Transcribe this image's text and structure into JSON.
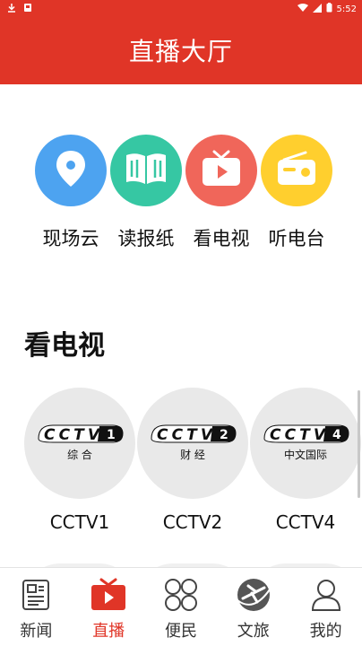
{
  "status_bar": {
    "time": "5:52"
  },
  "header": {
    "title": "直播大厅"
  },
  "quick_links": [
    {
      "label": "现场云",
      "icon": "location-pin-icon",
      "color": "#4da3f0"
    },
    {
      "label": "读报纸",
      "icon": "book-icon",
      "color": "#36c7a3"
    },
    {
      "label": "看电视",
      "icon": "tv-icon",
      "color": "#f0665a"
    },
    {
      "label": "听电台",
      "icon": "radio-icon",
      "color": "#ffcf2e"
    }
  ],
  "section": {
    "title": "看电视"
  },
  "channels": [
    {
      "name": "CCTV1",
      "logo_number": "1",
      "logo_caption": "综 合"
    },
    {
      "name": "CCTV2",
      "logo_number": "2",
      "logo_caption": "财 经"
    },
    {
      "name": "CCTV4",
      "logo_number": "4",
      "logo_caption": "中文国际"
    }
  ],
  "tabs": [
    {
      "label": "新闻",
      "icon": "newspaper-icon",
      "active": false
    },
    {
      "label": "直播",
      "icon": "tv-play-icon",
      "active": true
    },
    {
      "label": "便民",
      "icon": "grid-icon",
      "active": false
    },
    {
      "label": "文旅",
      "icon": "plane-icon",
      "active": false
    },
    {
      "label": "我的",
      "icon": "person-icon",
      "active": false
    }
  ],
  "colors": {
    "brand_red": "#e03527"
  }
}
